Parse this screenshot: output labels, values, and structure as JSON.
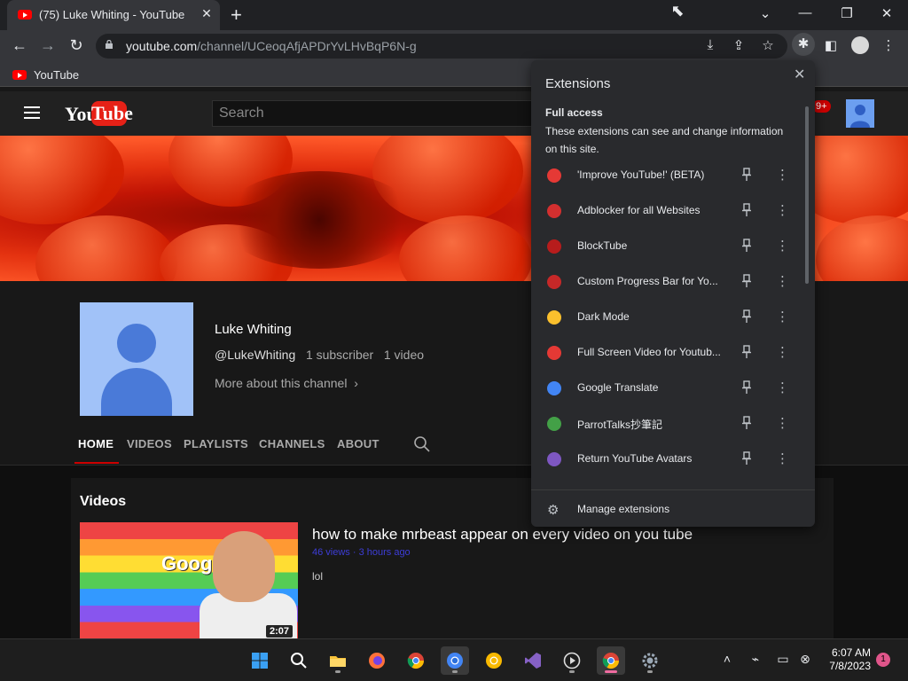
{
  "browser": {
    "tab_title": "(75) Luke Whiting - YouTube",
    "url_host": "youtube.com",
    "url_path": "/channel/UCeoqAfjAPDrYvLHvBqP6N-g",
    "bookmark_label": "YouTube"
  },
  "youtube": {
    "search_placeholder": "Search",
    "notification_count": "9+",
    "logo_you": "You",
    "logo_tube": "Tube"
  },
  "channel": {
    "name": "Luke Whiting",
    "handle": "@LukeWhiting",
    "subscribers": "1 subscriber",
    "videos_count": "1 video",
    "more_about": "More about this channel",
    "tabs": [
      "HOME",
      "VIDEOS",
      "PLAYLISTS",
      "CHANNELS",
      "ABOUT"
    ]
  },
  "videos": {
    "section_title": "Videos",
    "item": {
      "title": "how to make mrbeast appear on every video on you tube",
      "views": "46 views",
      "age": "3 hours ago",
      "description": "lol",
      "duration": "2:07",
      "thumb_text": "Google"
    }
  },
  "extensions_panel": {
    "header": "Extensions",
    "section_title": "Full access",
    "section_desc": "These extensions can see and change information on this site.",
    "items": [
      {
        "name": "'Improve YouTube!' (BETA)",
        "color": "#e53935"
      },
      {
        "name": "Adblocker for all Websites",
        "color": "#d32f2f"
      },
      {
        "name": "BlockTube",
        "color": "#b71c1c"
      },
      {
        "name": "Custom Progress Bar for Yo...",
        "color": "#c62828"
      },
      {
        "name": "Dark Mode",
        "color": "#fbc02d"
      },
      {
        "name": "Full Screen Video for Youtub...",
        "color": "#e53935"
      },
      {
        "name": "Google Translate",
        "color": "#4285f4"
      },
      {
        "name": "ParrotTalks抄筆記",
        "color": "#43a047"
      },
      {
        "name": "Return YouTube Avatars",
        "color": "#7e57c2"
      }
    ],
    "manage_label": "Manage extensions"
  },
  "taskbar": {
    "time": "6:07 AM",
    "date": "7/8/2023",
    "notification_count": "1"
  }
}
